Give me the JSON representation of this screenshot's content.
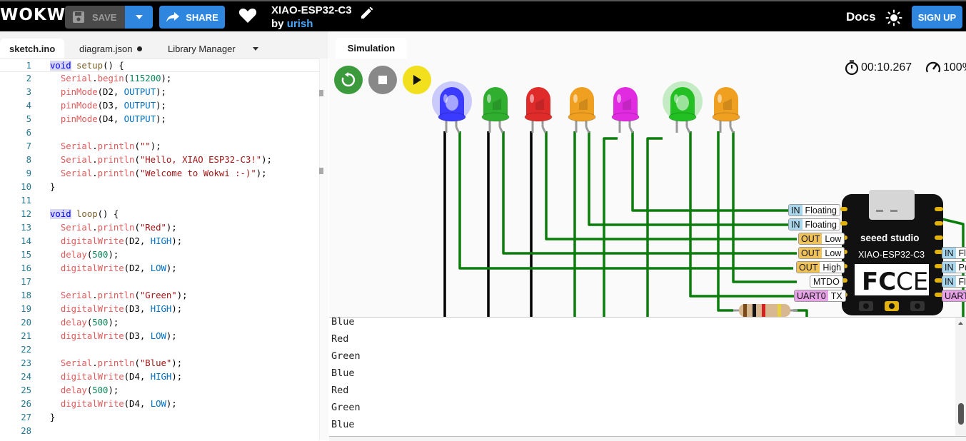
{
  "header": {
    "logo": "WOKWi",
    "save_label": "SAVE",
    "share_label": "SHARE",
    "project_title": "XIAO-ESP32-C3",
    "by_label": "by",
    "author": "urish",
    "docs_label": "Docs",
    "signup_label": "SIGN UP"
  },
  "editor": {
    "tabs": [
      {
        "label": "sketch.ino",
        "active": true
      },
      {
        "label": "diagram.json",
        "modified": true
      },
      {
        "label": "Library Manager",
        "dropdown": true
      }
    ],
    "lines": [
      {
        "n": "1",
        "code": "void setup() {"
      },
      {
        "n": "2",
        "code": "  Serial.begin(115200);"
      },
      {
        "n": "3",
        "code": "  pinMode(D2, OUTPUT);"
      },
      {
        "n": "4",
        "code": "  pinMode(D3, OUTPUT);"
      },
      {
        "n": "5",
        "code": "  pinMode(D4, OUTPUT);"
      },
      {
        "n": "6",
        "code": ""
      },
      {
        "n": "7",
        "code": "  Serial.println(\"\");"
      },
      {
        "n": "8",
        "code": "  Serial.println(\"Hello, XIAO ESP32-C3!\");"
      },
      {
        "n": "9",
        "code": "  Serial.println(\"Welcome to Wokwi :-)\");"
      },
      {
        "n": "10",
        "code": "}"
      },
      {
        "n": "11",
        "code": ""
      },
      {
        "n": "12",
        "code": "void loop() {"
      },
      {
        "n": "13",
        "code": "  Serial.println(\"Red\");"
      },
      {
        "n": "14",
        "code": "  digitalWrite(D2, HIGH);"
      },
      {
        "n": "15",
        "code": "  delay(500);"
      },
      {
        "n": "16",
        "code": "  digitalWrite(D2, LOW);"
      },
      {
        "n": "17",
        "code": ""
      },
      {
        "n": "18",
        "code": "  Serial.println(\"Green\");"
      },
      {
        "n": "19",
        "code": "  digitalWrite(D3, HIGH);"
      },
      {
        "n": "20",
        "code": "  delay(500);"
      },
      {
        "n": "21",
        "code": "  digitalWrite(D3, LOW);"
      },
      {
        "n": "22",
        "code": ""
      },
      {
        "n": "23",
        "code": "  Serial.println(\"Blue\");"
      },
      {
        "n": "24",
        "code": "  digitalWrite(D4, HIGH);"
      },
      {
        "n": "25",
        "code": "  delay(500);"
      },
      {
        "n": "26",
        "code": "  digitalWrite(D4, LOW);"
      },
      {
        "n": "27",
        "code": "}"
      },
      {
        "n": "28",
        "code": ""
      }
    ]
  },
  "simulation": {
    "tab_label": "Simulation",
    "timer": "00:10.267",
    "speed": "100%",
    "leds": [
      {
        "color": "#3b3bff",
        "lit": true
      },
      {
        "color": "#2fae2f",
        "lit": false
      },
      {
        "color": "#e02b2b",
        "lit": false
      },
      {
        "color": "#f0a020",
        "lit": false
      },
      {
        "color": "#e02be0",
        "lit": false
      },
      {
        "color": "#22c022",
        "lit": true
      },
      {
        "color": "#f0a020",
        "lit": false
      }
    ],
    "board": {
      "brand": "seeed studio",
      "name": "XIAO-ESP32-C3"
    },
    "pins_left": [
      {
        "dir": "IN",
        "value": "Floating"
      },
      {
        "dir": "IN",
        "value": "Floating"
      },
      {
        "dir": "OUT",
        "value": "Low"
      },
      {
        "dir": "OUT",
        "value": "Low"
      },
      {
        "dir": "OUT",
        "value": "High"
      },
      {
        "dir": "",
        "value": "MTDO"
      },
      {
        "dir": "UART0",
        "value": "TX"
      }
    ],
    "pins_right": [
      {
        "dir": "IN",
        "value": "Fl"
      },
      {
        "dir": "IN",
        "value": "Pu"
      },
      {
        "dir": "IN",
        "value": "Fl"
      },
      {
        "dir": "UART",
        "value": ""
      }
    ]
  },
  "serial_monitor": {
    "lines": [
      "Blue",
      "Red",
      "Green",
      "Blue",
      "Red",
      "Green",
      "Blue"
    ]
  }
}
